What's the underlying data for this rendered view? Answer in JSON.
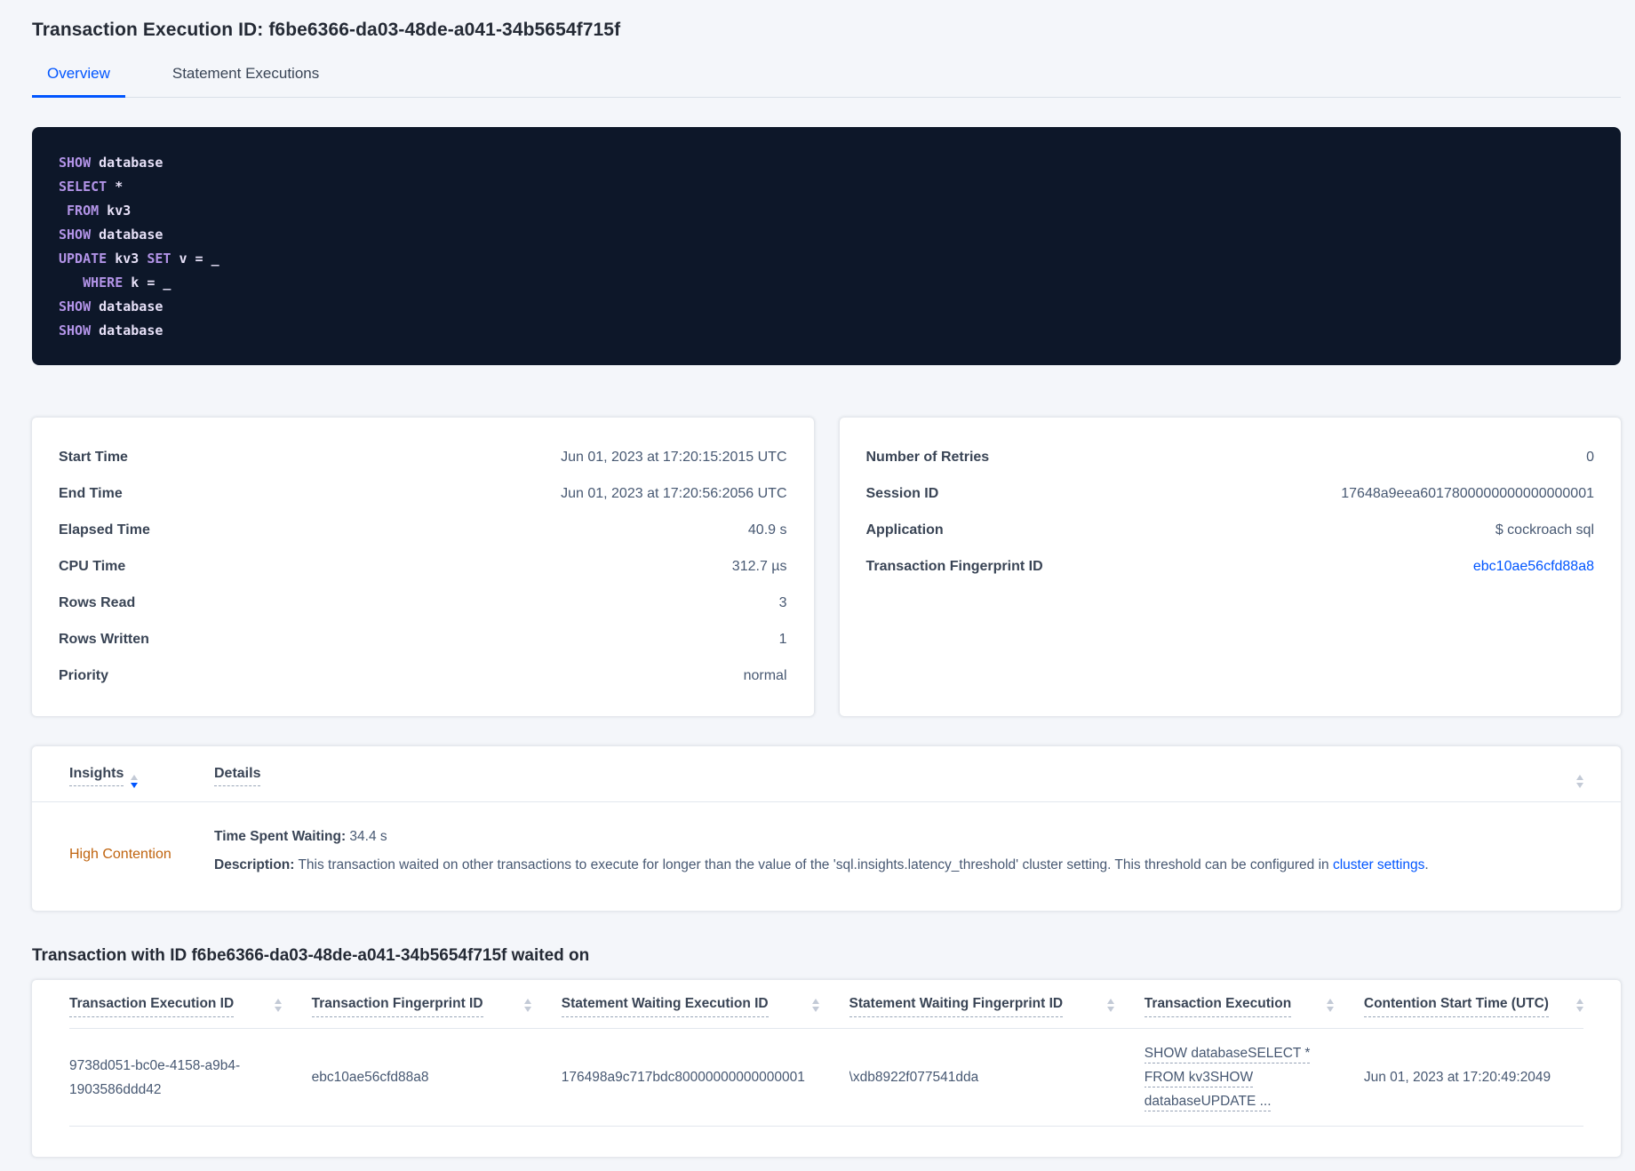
{
  "page": {
    "title": "Transaction Execution ID: f6be6366-da03-48de-a041-34b5654f715f"
  },
  "tabs": [
    {
      "label": "Overview"
    },
    {
      "label": "Statement Executions"
    }
  ],
  "sql": {
    "lines": [
      [
        [
          "k",
          "SHOW"
        ],
        [
          "p",
          " database"
        ]
      ],
      [
        [
          "k",
          "SELECT"
        ],
        [
          "p",
          " *"
        ]
      ],
      [
        [
          "p",
          " "
        ],
        [
          "k",
          "FROM"
        ],
        [
          "p",
          " kv3"
        ]
      ],
      [
        [
          "k",
          "SHOW"
        ],
        [
          "p",
          " database"
        ]
      ],
      [
        [
          "k",
          "UPDATE"
        ],
        [
          "p",
          " kv3 "
        ],
        [
          "k",
          "SET"
        ],
        [
          "p",
          " v = _"
        ]
      ],
      [
        [
          "p",
          "   "
        ],
        [
          "k",
          "WHERE"
        ],
        [
          "p",
          " k = _"
        ]
      ],
      [
        [
          "k",
          "SHOW"
        ],
        [
          "p",
          " database"
        ]
      ],
      [
        [
          "k",
          "SHOW"
        ],
        [
          "p",
          " database"
        ]
      ]
    ]
  },
  "details_left": {
    "rows": [
      {
        "label": "Start Time",
        "value": "Jun 01, 2023 at 17:20:15:2015 UTC"
      },
      {
        "label": "End Time",
        "value": "Jun 01, 2023 at 17:20:56:2056 UTC"
      },
      {
        "label": "Elapsed Time",
        "value": "40.9 s"
      },
      {
        "label": "CPU Time",
        "value": "312.7 µs"
      },
      {
        "label": "Rows Read",
        "value": "3"
      },
      {
        "label": "Rows Written",
        "value": "1"
      },
      {
        "label": "Priority",
        "value": "normal"
      }
    ]
  },
  "details_right": {
    "rows": [
      {
        "label": "Number of Retries",
        "value": "0"
      },
      {
        "label": "Session ID",
        "value": "17648a9eea6017800000000000000001"
      },
      {
        "label": "Application",
        "value": "$ cockroach sql"
      }
    ],
    "fingerprint_label": "Transaction Fingerprint ID",
    "fingerprint_value": "ebc10ae56cfd88a8"
  },
  "insights": {
    "col_insights": "Insights",
    "col_details": "Details",
    "row": {
      "insight": "High Contention",
      "waiting_label": "Time Spent Waiting:",
      "waiting_value": " 34.4 s",
      "description_label": "Description:",
      "description_text": " This transaction waited on other transactions to execute for longer than the value of the 'sql.insights.latency_threshold' cluster setting. This threshold can be configured in ",
      "description_link": "cluster settings",
      "description_suffix": "."
    }
  },
  "waited_on": {
    "heading": "Transaction with ID f6be6366-da03-48de-a041-34b5654f715f waited on",
    "columns": [
      "Transaction Execution ID",
      "Transaction Fingerprint ID",
      "Statement Waiting Execution ID",
      "Statement Waiting Fingerprint ID",
      "Transaction Execution",
      "Contention Start Time (UTC)"
    ],
    "row": {
      "transaction_execution_id": "9738d051-bc0e-4158-a9b4-1903586ddd42",
      "transaction_fingerprint_id": "ebc10ae56cfd88a8",
      "statement_waiting_execution_id": "176498a9c717bdc80000000000000001",
      "statement_waiting_fingerprint_id": "\\xdb8922f077541dda",
      "transaction_execution": "SHOW databaseSELECT * FROM kv3SHOW databaseUPDATE ...",
      "contention_start_time": "Jun 01, 2023 at 17:20:49:2049"
    }
  },
  "colors": {
    "accent_blue": "#0055ff",
    "insight_orange": "#c0640f",
    "code_background": "#0d1729",
    "code_keyword": "#b394e8",
    "code_text": "#e6e0f7",
    "page_background": "#f4f6fa"
  }
}
